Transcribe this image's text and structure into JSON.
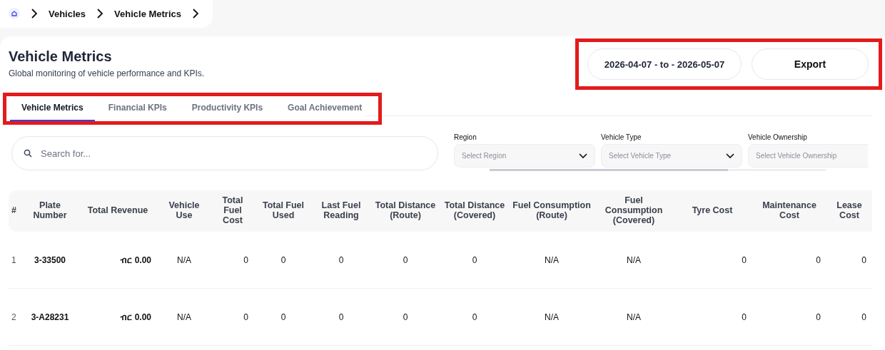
{
  "breadcrumb": {
    "items": [
      "Vehicles",
      "Vehicle Metrics"
    ]
  },
  "header": {
    "title": "Vehicle Metrics",
    "subtitle": "Global monitoring of vehicle performance and KPIs.",
    "date_range": "2026-04-07 - to - 2026-05-07",
    "export_button": "Export"
  },
  "tabs": [
    {
      "label": "Vehicle Metrics",
      "selected": true
    },
    {
      "label": "Financial KPIs",
      "selected": false
    },
    {
      "label": "Productivity KPIs",
      "selected": false
    },
    {
      "label": "Goal Achievement",
      "selected": false
    }
  ],
  "search": {
    "placeholder": "Search for..."
  },
  "filters": [
    {
      "label": "Region",
      "placeholder": "Select Region"
    },
    {
      "label": "Vehicle Type",
      "placeholder": "Select Vehicle Type"
    },
    {
      "label": "Vehicle Ownership",
      "placeholder": "Select Vehicle Ownership"
    }
  ],
  "table": {
    "columns": [
      "#",
      "Plate Number",
      "Total Revenue",
      "Vehicle Use",
      "Total Fuel Cost",
      "Total Fuel Used",
      "Last Fuel Reading",
      "Total Distance (Route)",
      "Total Distance (Covered)",
      "Fuel Consumption (Route)",
      "Fuel Consumption (Covered)",
      "Tyre Cost",
      "Maintenance Cost",
      "Lease Cost"
    ],
    "rows": [
      [
        "1",
        "3-33500",
        "ብር 0.00",
        "N/A",
        "0",
        "0",
        "0",
        "0",
        "0",
        "N/A",
        "N/A",
        "0",
        "0",
        "0"
      ],
      [
        "2",
        "3-A28231",
        "ብር 0.00",
        "N/A",
        "0",
        "0",
        "0",
        "0",
        "0",
        "N/A",
        "N/A",
        "0",
        "0",
        "0"
      ]
    ]
  }
}
